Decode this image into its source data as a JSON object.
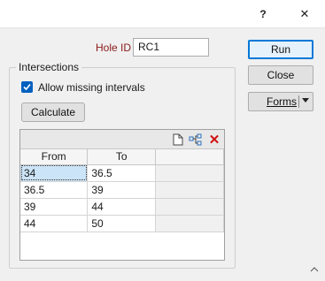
{
  "titlebar": {
    "help_label": "?",
    "close_glyph": "✕"
  },
  "form": {
    "hole_id_label": "Hole ID",
    "hole_id_value": "RC1"
  },
  "buttons": {
    "run": "Run",
    "close": "Close",
    "forms": "Forms",
    "calculate": "Calculate"
  },
  "intersections": {
    "group_title": "Intersections",
    "allow_missing_label": "Allow missing intervals",
    "allow_missing_checked": true
  },
  "grid": {
    "toolbar_icons": [
      "new-document-icon",
      "tree-structure-icon",
      "delete-icon"
    ],
    "columns": [
      "From",
      "To",
      ""
    ],
    "rows": [
      {
        "from": "34",
        "to": "36.5"
      },
      {
        "from": "36.5",
        "to": "39"
      },
      {
        "from": "39",
        "to": "44"
      },
      {
        "from": "44",
        "to": "50"
      }
    ]
  },
  "colors": {
    "accent": "#0060c0",
    "label_red": "#8b1a1a",
    "delete_red": "#d01010",
    "selection": "#cce4f7"
  }
}
